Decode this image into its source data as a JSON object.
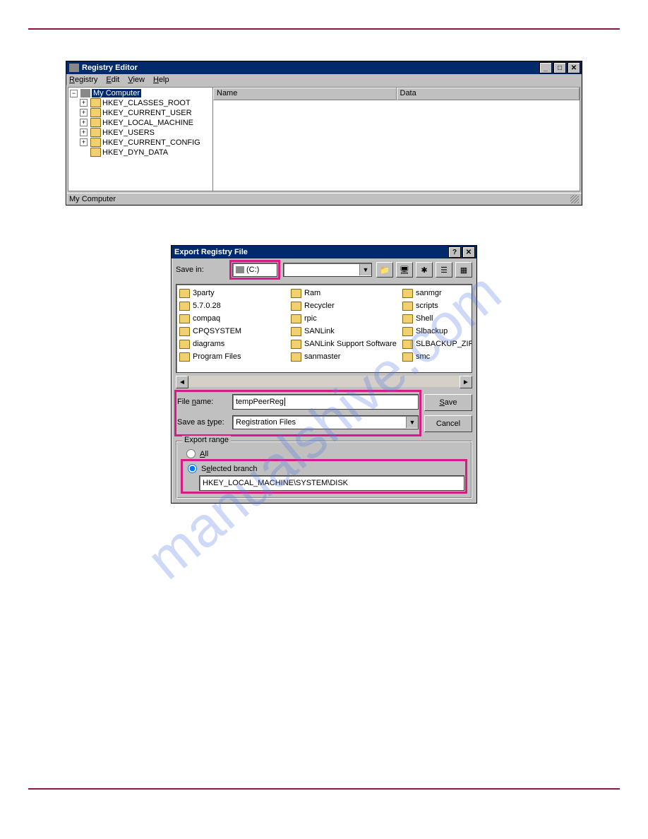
{
  "watermark": "manualshive.com",
  "registry_editor": {
    "title": "Registry Editor",
    "menu": [
      "Registry",
      "Edit",
      "View",
      "Help"
    ],
    "root": "My Computer",
    "keys": [
      "HKEY_CLASSES_ROOT",
      "HKEY_CURRENT_USER",
      "HKEY_LOCAL_MACHINE",
      "HKEY_USERS",
      "HKEY_CURRENT_CONFIG",
      "HKEY_DYN_DATA"
    ],
    "columns": [
      "Name",
      "Data"
    ],
    "status": "My Computer"
  },
  "export_dialog": {
    "title": "Export Registry File",
    "save_in_label": "Save in:",
    "save_in_value": "(C:)",
    "folders": [
      "3party",
      "5.7.0.28",
      "compaq",
      "CPQSYSTEM",
      "diagrams",
      "Program Files",
      "Ram",
      "Recycler",
      "rpic",
      "SANLink",
      "SANLink Support Software",
      "sanmaster",
      "sanmgr",
      "scripts",
      "Shell",
      "Slbackup",
      "SLBACKUP_ZIP",
      "smc"
    ],
    "filename_label": "File name:",
    "filename_value": "tempPeerReg",
    "savetype_label": "Save as type:",
    "savetype_value": "Registration Files",
    "save_btn": "Save",
    "cancel_btn": "Cancel",
    "export_range_label": "Export range",
    "all_label": "All",
    "selected_branch_label": "Selected branch",
    "selected_branch_value": "HKEY_LOCAL_MACHINE\\SYSTEM\\DISK"
  }
}
